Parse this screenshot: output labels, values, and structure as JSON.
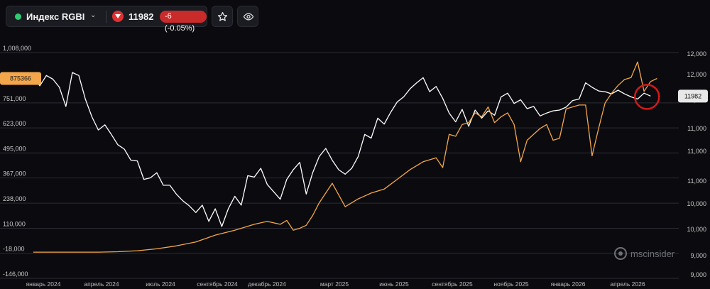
{
  "toolbar": {
    "ticker_name": "Индекс RGBI",
    "price": "11982",
    "change": "-6 (-0.05%)",
    "status_color": "#2ecc71",
    "change_color": "#c92a2a",
    "icons": [
      "chevron-down-icon",
      "arrow-down-icon",
      "star-icon",
      "eye-icon"
    ]
  },
  "watermark": "mscinsider",
  "chart_data": {
    "type": "line",
    "left_axis": {
      "ticks": [
        "1,008,000",
        "751,000",
        "623,000",
        "495,000",
        "367,000",
        "238,000",
        "110,000",
        "-18,000",
        "-146,000"
      ],
      "tick_values": [
        1008000,
        751000,
        623000,
        495000,
        367000,
        238000,
        110000,
        -18000,
        -146000
      ],
      "ylim": [
        -146000,
        1008000
      ]
    },
    "right_axis": {
      "ticks": [
        "12,000",
        "12,000",
        "12,000",
        "11,000",
        "11,000",
        "11,000",
        "10,000",
        "10,000",
        "9,000",
        "9,000"
      ],
      "ylim": [
        9000,
        12200
      ]
    },
    "x_ticks": [
      "январь 2024",
      "апрель 2024",
      "июль 2024",
      "сентябрь 2024",
      "декабрь 2024",
      "март 2025",
      "июнь 2025",
      "сентябрь 2025",
      "ноябрь 2025",
      "январь 2026",
      "апрель 2026"
    ],
    "markers": {
      "left_value": "875366",
      "right_value": "11982"
    },
    "series": [
      {
        "color": "#ffffff",
        "axis": "right",
        "points": [
          [
            0,
            11830
          ],
          [
            1,
            11720
          ],
          [
            2,
            11860
          ],
          [
            3,
            11810
          ],
          [
            4,
            11700
          ],
          [
            5,
            11440
          ],
          [
            6,
            11900
          ],
          [
            7,
            11860
          ],
          [
            8,
            11540
          ],
          [
            9,
            11300
          ],
          [
            10,
            11120
          ],
          [
            11,
            11190
          ],
          [
            12,
            11060
          ],
          [
            13,
            10920
          ],
          [
            14,
            10860
          ],
          [
            15,
            10710
          ],
          [
            16,
            10700
          ],
          [
            17,
            10450
          ],
          [
            18,
            10470
          ],
          [
            19,
            10540
          ],
          [
            20,
            10370
          ],
          [
            21,
            10370
          ],
          [
            22,
            10250
          ],
          [
            23,
            10160
          ],
          [
            24,
            10090
          ],
          [
            25,
            10000
          ],
          [
            26,
            10100
          ],
          [
            27,
            9880
          ],
          [
            28,
            10050
          ],
          [
            29,
            9810
          ],
          [
            30,
            10050
          ],
          [
            31,
            10220
          ],
          [
            32,
            10100
          ],
          [
            33,
            10500
          ],
          [
            34,
            10480
          ],
          [
            35,
            10600
          ],
          [
            36,
            10380
          ],
          [
            37,
            10280
          ],
          [
            38,
            10180
          ],
          [
            39,
            10450
          ],
          [
            40,
            10580
          ],
          [
            41,
            10680
          ],
          [
            42,
            10250
          ],
          [
            43,
            10540
          ],
          [
            44,
            10760
          ],
          [
            45,
            10870
          ],
          [
            46,
            10710
          ],
          [
            47,
            10580
          ],
          [
            48,
            10520
          ],
          [
            49,
            10600
          ],
          [
            50,
            10760
          ],
          [
            51,
            11060
          ],
          [
            52,
            11010
          ],
          [
            53,
            11280
          ],
          [
            54,
            11200
          ],
          [
            55,
            11360
          ],
          [
            56,
            11500
          ],
          [
            57,
            11570
          ],
          [
            58,
            11680
          ],
          [
            59,
            11760
          ],
          [
            60,
            11830
          ],
          [
            61,
            11640
          ],
          [
            62,
            11710
          ],
          [
            63,
            11550
          ],
          [
            64,
            11350
          ],
          [
            65,
            11230
          ],
          [
            66,
            11400
          ],
          [
            67,
            11170
          ],
          [
            68,
            11390
          ],
          [
            69,
            11280
          ],
          [
            70,
            11380
          ],
          [
            71,
            11320
          ],
          [
            72,
            11570
          ],
          [
            73,
            11620
          ],
          [
            74,
            11480
          ],
          [
            75,
            11530
          ],
          [
            76,
            11410
          ],
          [
            77,
            11440
          ],
          [
            78,
            11310
          ],
          [
            79,
            11350
          ],
          [
            80,
            11380
          ],
          [
            81,
            11390
          ],
          [
            82,
            11430
          ],
          [
            83,
            11520
          ],
          [
            84,
            11540
          ],
          [
            85,
            11760
          ],
          [
            86,
            11700
          ],
          [
            87,
            11650
          ],
          [
            88,
            11640
          ],
          [
            89,
            11610
          ],
          [
            90,
            11660
          ],
          [
            91,
            11610
          ],
          [
            92,
            11570
          ],
          [
            93,
            11540
          ],
          [
            94,
            11620
          ],
          [
            95,
            11580
          ]
        ]
      },
      {
        "color": "#f4a74a",
        "axis": "left",
        "points": [
          [
            0,
            -12000
          ],
          [
            5,
            -12000
          ],
          [
            10,
            -12000
          ],
          [
            13,
            -10000
          ],
          [
            16,
            -5000
          ],
          [
            19,
            5000
          ],
          [
            22,
            20000
          ],
          [
            25,
            40000
          ],
          [
            28,
            75000
          ],
          [
            31,
            100000
          ],
          [
            34,
            130000
          ],
          [
            36,
            145000
          ],
          [
            38,
            130000
          ],
          [
            39,
            150000
          ],
          [
            40,
            100000
          ],
          [
            41,
            110000
          ],
          [
            42,
            125000
          ],
          [
            43,
            175000
          ],
          [
            44,
            240000
          ],
          [
            45,
            290000
          ],
          [
            46,
            340000
          ],
          [
            47,
            280000
          ],
          [
            48,
            220000
          ],
          [
            49,
            240000
          ],
          [
            50,
            260000
          ],
          [
            52,
            290000
          ],
          [
            54,
            310000
          ],
          [
            56,
            360000
          ],
          [
            58,
            410000
          ],
          [
            60,
            450000
          ],
          [
            62,
            470000
          ],
          [
            63,
            420000
          ],
          [
            64,
            590000
          ],
          [
            65,
            580000
          ],
          [
            66,
            640000
          ],
          [
            67,
            650000
          ],
          [
            68,
            700000
          ],
          [
            69,
            680000
          ],
          [
            70,
            730000
          ],
          [
            71,
            650000
          ],
          [
            72,
            680000
          ],
          [
            73,
            700000
          ],
          [
            74,
            640000
          ],
          [
            75,
            450000
          ],
          [
            76,
            560000
          ],
          [
            78,
            620000
          ],
          [
            79,
            640000
          ],
          [
            80,
            560000
          ],
          [
            81,
            570000
          ],
          [
            82,
            720000
          ],
          [
            83,
            730000
          ],
          [
            84,
            740000
          ],
          [
            85,
            740000
          ],
          [
            86,
            480000
          ],
          [
            87,
            620000
          ],
          [
            88,
            750000
          ],
          [
            89,
            800000
          ],
          [
            90,
            840000
          ],
          [
            91,
            870000
          ],
          [
            92,
            880000
          ],
          [
            93,
            960000
          ],
          [
            94,
            810000
          ],
          [
            95,
            860000
          ],
          [
            96,
            875366
          ]
        ]
      }
    ]
  }
}
